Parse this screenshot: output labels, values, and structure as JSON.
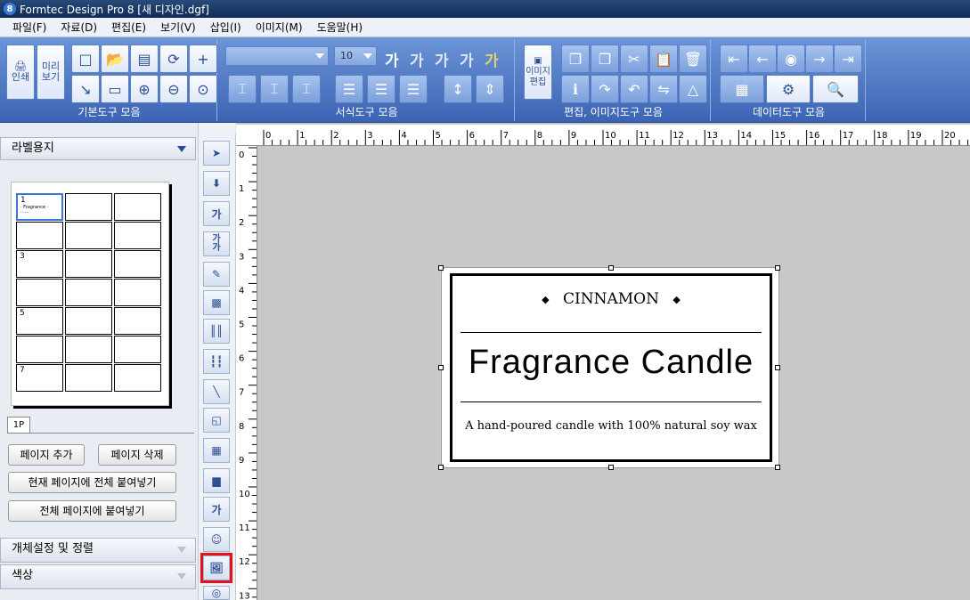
{
  "window": {
    "title": "Formtec Design Pro 8 [새 디자인.dgf]",
    "app_icon": "8"
  },
  "menu": [
    "파일(F)",
    "자료(D)",
    "편집(E)",
    "보기(V)",
    "삽입(I)",
    "이미지(M)",
    "도움말(H)"
  ],
  "toolbar": {
    "print_label": "인쇄",
    "preview_label": "미리\n보기",
    "image_edit_label": "이미지\n편집",
    "font_size_value": "10",
    "font_glyphs": [
      "가",
      "가",
      "가",
      "가",
      "가"
    ],
    "group_labels": [
      "기본도구 모음",
      "서식도구 모음",
      "편집, 이미지도구 모음",
      "데이터도구 모음"
    ]
  },
  "left_panel": {
    "label_paper_header": "라벨용지",
    "cell_numbers": [
      "1",
      "3",
      "5",
      "7"
    ],
    "page_tab": "1P",
    "buttons": {
      "add_page": "페이지 추가",
      "delete_page": "페이지 삭제",
      "paste_all_current": "현재 페이지에 전체 붙여넣기",
      "paste_all_pages": "전체 페이지에 붙여넣기"
    },
    "object_settings_header": "개체설정 및 정렬",
    "color_header": "색상"
  },
  "side_tools": [
    "select-tool",
    "import-tool",
    "text-tool",
    "vertical-text-tool",
    "text-edit-tool",
    "qr-code-tool",
    "barcode-tool",
    "barcode2-tool",
    "line-tool",
    "shape-tool",
    "table-tool",
    "gradient-tool",
    "wordart-tool",
    "clipart-tool",
    "image-tool",
    "circle-tool"
  ],
  "ruler": {
    "horizontal": [
      "0",
      "1",
      "2",
      "3",
      "4",
      "5",
      "6",
      "7",
      "8",
      "9",
      "10",
      "11",
      "12",
      "13",
      "14",
      "15",
      "16",
      "17",
      "18",
      "19",
      "20"
    ],
    "vertical": [
      "0",
      "1",
      "2",
      "3",
      "4",
      "5",
      "6",
      "7",
      "8",
      "9",
      "10",
      "11",
      "12",
      "13"
    ]
  },
  "label_design": {
    "top_text": "CINNAMON",
    "title": "Fragrance Candle",
    "subtitle": "A hand-poured candle with 100% natural soy wax"
  },
  "colors": {
    "ribbon": "#4a74c4",
    "highlight": "#e8101a",
    "canvas": "#c8c8c8"
  }
}
